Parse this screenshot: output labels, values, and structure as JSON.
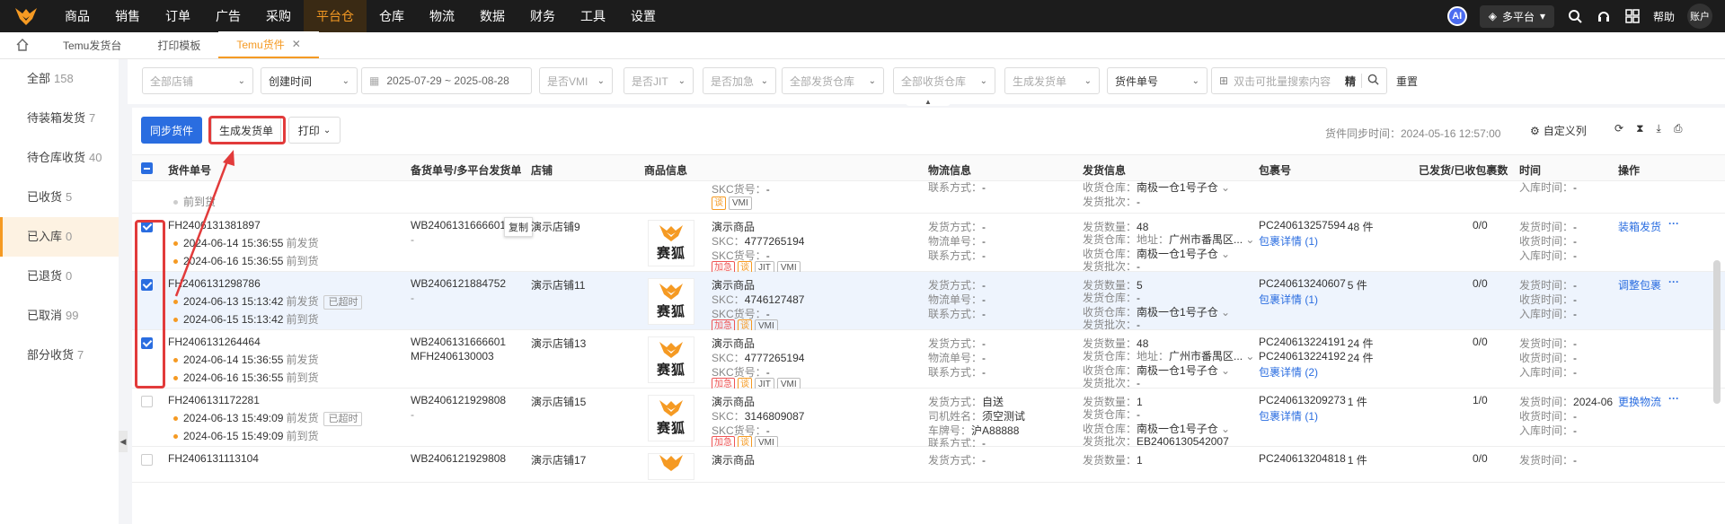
{
  "nav": {
    "items": [
      "商品",
      "销售",
      "订单",
      "广告",
      "采购",
      "平台仓",
      "仓库",
      "物流",
      "数据",
      "财务",
      "工具",
      "设置"
    ],
    "active_index": 5,
    "ai_label": "AI",
    "platform_label": "多平台",
    "help_label": "帮助",
    "account_label": "账户"
  },
  "tabs": [
    {
      "label": "Temu发货台"
    },
    {
      "label": "打印模板"
    },
    {
      "label": "Temu货件"
    }
  ],
  "sidebar": {
    "items": [
      {
        "label": "全部",
        "count": "158"
      },
      {
        "label": "待装箱发货",
        "count": "7"
      },
      {
        "label": "待仓库收货",
        "count": "40"
      },
      {
        "label": "已收货",
        "count": "5"
      },
      {
        "label": "已入库",
        "count": "0"
      },
      {
        "label": "已退货",
        "count": "0"
      },
      {
        "label": "已取消",
        "count": "99"
      },
      {
        "label": "部分收货",
        "count": "7"
      }
    ],
    "active_index": 4
  },
  "filters": {
    "store": "全部店铺",
    "time_type": "创建时间",
    "date_range": "2025-07-29 ~ 2025-08-28",
    "vmi": "是否VMI",
    "jit": "是否JIT",
    "urgent": "是否加急",
    "ship_wh": "全部发货仓库",
    "recv_wh": "全部收货仓库",
    "gen_order": "生成发货单",
    "search_type": "货件单号",
    "search_placeholder": "双击可批量搜索内容",
    "exact": "精",
    "reset": "重置"
  },
  "toolbar": {
    "sync": "同步货件",
    "generate": "生成发货单",
    "print": "打印",
    "sync_time": "货件同步时间：2024-05-16 12:57:00",
    "custom_cols": "自定义列"
  },
  "columns": [
    "货件单号",
    "备货单号/多平台发货单",
    "店铺",
    "商品信息",
    "物流信息",
    "发货信息",
    "包裹号",
    "已发货/已收包裹数",
    "时间",
    "操作"
  ],
  "partial_row": {
    "stock": "前到货",
    "skc_label": "SKC货号：",
    "skc_val": "-",
    "contact": "联系方式：",
    "contact_val": "-",
    "recv_wh_label": "收货仓库：",
    "recv_wh_val": "南极一仓1号子仓",
    "batch_label": "发货批次：",
    "batch_val": "-",
    "instock_label": "入库时间：",
    "instock_val": "-"
  },
  "rows": [
    {
      "id": "FH2406131381897",
      "t1": "2024-06-14 15:36:55",
      "t1s": "前发货",
      "t2": "2024-06-16 15:36:55",
      "t2s": "前到货",
      "over": "",
      "stock": "WB2406131666601",
      "stock2": "-",
      "copy": "复制",
      "store": "演示店铺9",
      "pname": "演示商品",
      "skc": "4777265194",
      "skcno": "-",
      "ship_way": "-",
      "logi_no": "-",
      "contact": "-",
      "qty": "48",
      "addr": "广州市番禺区...",
      "recv": "南极一仓1号子仓",
      "batch": "-",
      "pkg1": "PC240613257594",
      "pkg1c": "48 件",
      "pkg2": "",
      "pkg2c": "",
      "pkgdetail": "包裹详情 (1)",
      "ratio": "0/0",
      "ship_time": "-",
      "recv_time": "-",
      "in_time": "-",
      "action": "装箱发货"
    },
    {
      "id": "FH2406131298786",
      "t1": "2024-06-13 15:13:42",
      "t1s": "前发货",
      "t2": "2024-06-15 15:13:42",
      "t2s": "前到货",
      "over": "已超时",
      "stock": "WB2406121884752",
      "stock2": "-",
      "store": "演示店铺11",
      "pname": "演示商品",
      "skc": "4746127487",
      "skcno": "-",
      "ship_way": "-",
      "logi_no": "-",
      "contact": "-",
      "qty": "5",
      "addr": "-",
      "recv": "南极一仓1号子仓",
      "batch": "-",
      "pkg1": "PC240613240607",
      "pkg1c": "5 件",
      "pkg2": "",
      "pkg2c": "",
      "pkgdetail": "包裹详情 (1)",
      "ratio": "0/0",
      "ship_time": "-",
      "recv_time": "-",
      "in_time": "-",
      "action": "调整包裹"
    },
    {
      "id": "FH2406131264464",
      "t1": "2024-06-14 15:36:55",
      "t1s": "前发货",
      "t2": "2024-06-16 15:36:55",
      "t2s": "前到货",
      "over": "",
      "stock": "WB2406131666601",
      "stock2": "MFH2406130003",
      "store": "演示店铺13",
      "pname": "演示商品",
      "skc": "4777265194",
      "skcno": "-",
      "ship_way": "-",
      "logi_no": "-",
      "contact": "-",
      "qty": "48",
      "addr": "广州市番禺区...",
      "recv": "南极一仓1号子仓",
      "batch": "-",
      "pkg1": "PC240613224191",
      "pkg1c": "24 件",
      "pkg2": "PC240613224192",
      "pkg2c": "24 件",
      "pkgdetail": "包裹详情 (2)",
      "ratio": "0/0",
      "ship_time": "-",
      "recv_time": "-",
      "in_time": "-",
      "action": ""
    },
    {
      "id": "FH2406131172281",
      "t1": "2024-06-13 15:49:09",
      "t1s": "前发货",
      "t2": "2024-06-15 15:49:09",
      "t2s": "前到货",
      "over": "已超时",
      "stock": "WB2406121929808",
      "stock2": "-",
      "store": "演示店铺15",
      "pname": "演示商品",
      "skc": "3146809087",
      "skcno": "-",
      "ship_way": "自送",
      "driver": "须空测试",
      "plate": "沪A88888",
      "qty": "1",
      "addr": "-",
      "recv": "南极一仓1号子仓",
      "batch": "EB2406130542007",
      "pkg1": "PC240613209273",
      "pkg1c": "1 件",
      "pkg2": "",
      "pkg2c": "",
      "pkgdetail": "包裹详情 (1)",
      "ratio": "1/0",
      "ship_time": "2024-06-",
      "recv_time": "-",
      "in_time": "-",
      "action": "更换物流"
    },
    {
      "id": "FH2406131113104",
      "stock": "WB2406121929808",
      "store": "演示店铺17",
      "pname": "演示商品",
      "ship_way": "-",
      "qty": "1",
      "pkg1": "PC240613204818",
      "pkg1c": "1 件",
      "ratio": "0/0",
      "ship_time": "-"
    }
  ],
  "labels": {
    "skc": "SKC：",
    "skcno": "SKC货号：",
    "ship_way": "发货方式：",
    "logi_no": "物流单号：",
    "contact": "联系方式：",
    "driver": "司机姓名：",
    "plate": "车牌号：",
    "qty": "发货数量：",
    "addr": "地址：",
    "ship_wh": "发货仓库：",
    "recv": "收货仓库：",
    "batch": "发货批次：",
    "ship_time": "发货时间：",
    "recv_time": "收货时间：",
    "in_time": "入库时间：",
    "urgent": "加急",
    "zhi": "谈",
    "jit": "JIT",
    "vmi": "VMI",
    "brand": "赛狐",
    "more": "···"
  },
  "colors": {
    "accent": "#f59a23",
    "primary": "#2a6de0",
    "highlight": "#e23b3b"
  }
}
